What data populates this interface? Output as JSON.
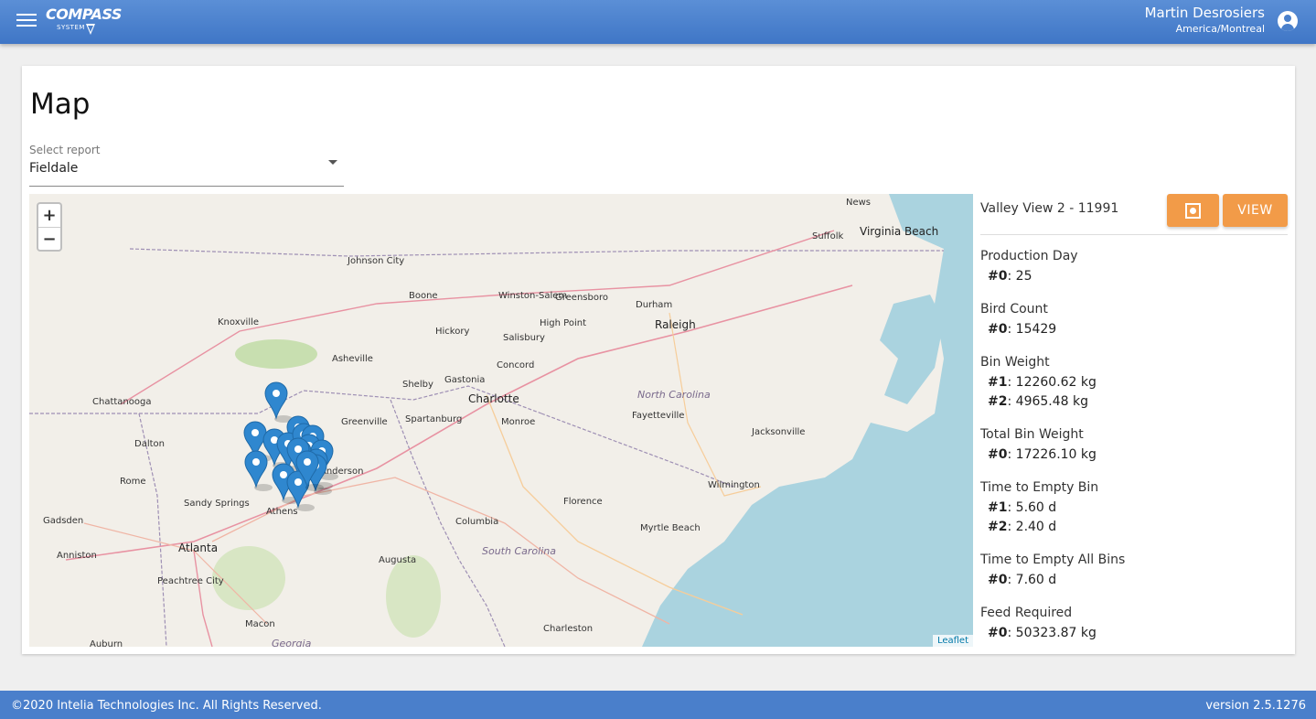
{
  "header": {
    "menu_icon": "hamburger-menu-icon",
    "logo_main": "COMPASS",
    "logo_sub": "SYSTEM",
    "user_name": "Martin Desrosiers",
    "user_timezone": "America/Montreal",
    "user_icon": "account-circle-icon"
  },
  "page": {
    "title": "Map"
  },
  "report_select": {
    "label": "Select report",
    "value": "Fieldale"
  },
  "map": {
    "zoom_in": "+",
    "zoom_out": "−",
    "attribution": "Leaflet",
    "states": [
      "North Carolina",
      "South Carolina",
      "Georgia"
    ],
    "cities": [
      "Johnson City",
      "Boone",
      "Winston-Salem",
      "Greensboro",
      "Durham",
      "Raleigh",
      "High Point",
      "Hickory",
      "Salisbury",
      "Knoxville",
      "Asheville",
      "Concord",
      "Gastonia",
      "Charlotte",
      "Shelby",
      "Monroe",
      "Chattanooga",
      "Spartanburg",
      "Greenville",
      "Fayetteville",
      "Jacksonville",
      "Dalton",
      "Anderson",
      "Rome",
      "Athens",
      "Sandy Springs",
      "Atlanta",
      "Gadsden",
      "Anniston",
      "Columbia",
      "Florence",
      "Wilmington",
      "Myrtle Beach",
      "Augusta",
      "Peachtree City",
      "Macon",
      "Charleston",
      "Auburn",
      "Suffolk",
      "Virginia Beach",
      "News"
    ],
    "markers_count": 17
  },
  "panel": {
    "title": "Valley View 2 - 11991",
    "focus_icon": "focus-target-icon",
    "view_label": "VIEW",
    "metrics": [
      {
        "name": "Production Day",
        "rows": [
          {
            "key": "#0",
            "value": "25"
          }
        ]
      },
      {
        "name": "Bird Count",
        "rows": [
          {
            "key": "#0",
            "value": "15429"
          }
        ]
      },
      {
        "name": "Bin Weight",
        "rows": [
          {
            "key": "#1",
            "value": "12260.62 kg"
          },
          {
            "key": "#2",
            "value": "4965.48 kg"
          }
        ]
      },
      {
        "name": "Total Bin Weight",
        "rows": [
          {
            "key": "#0",
            "value": "17226.10 kg"
          }
        ]
      },
      {
        "name": "Time to Empty Bin",
        "rows": [
          {
            "key": "#1",
            "value": "5.60 d"
          },
          {
            "key": "#2",
            "value": "2.40 d"
          }
        ]
      },
      {
        "name": "Time to Empty All Bins",
        "rows": [
          {
            "key": "#0",
            "value": "7.60 d"
          }
        ]
      },
      {
        "name": "Feed Required",
        "rows": [
          {
            "key": "#0",
            "value": "50323.87 kg"
          }
        ]
      }
    ]
  },
  "footer": {
    "copyright": "©2020 Intelia Technologies Inc. All Rights Reserved.",
    "version": "version 2.5.1276"
  }
}
